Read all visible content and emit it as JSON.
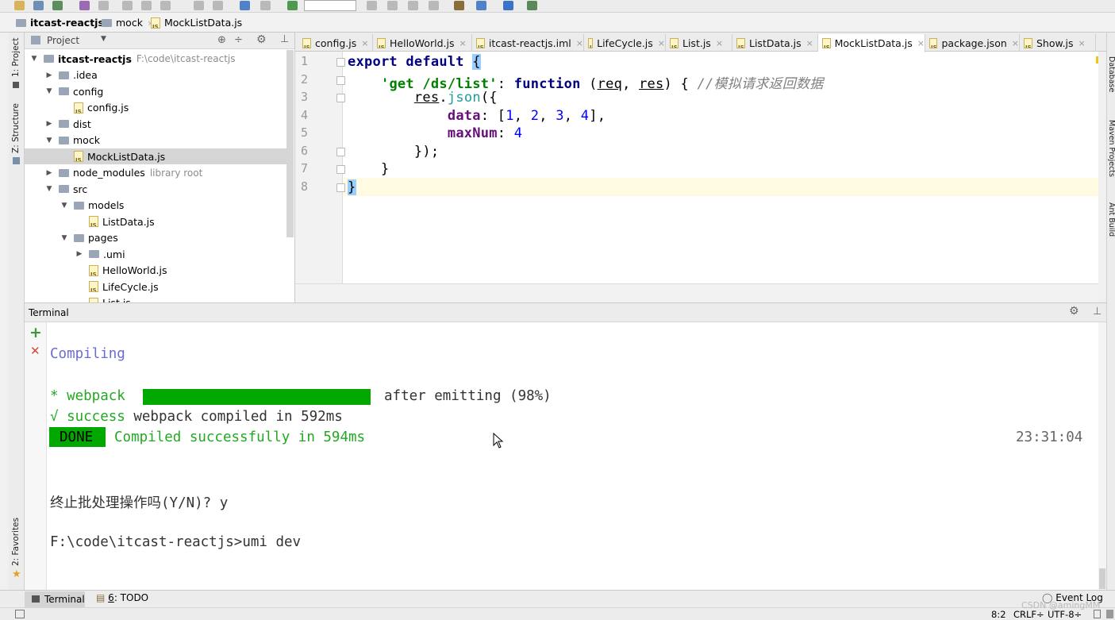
{
  "navbar": {
    "crumbs": [
      "itcast-reactjs",
      "mock",
      "MockListData.js"
    ]
  },
  "left_strip": {
    "project_tab": "1: Project",
    "structure_tab": "Z: Structure",
    "favorites_tab": "2: Favorites"
  },
  "right_strip": {
    "database_tab": "Database",
    "maven_tab": "Maven Projects",
    "ant_tab": "Ant Build"
  },
  "project_panel": {
    "title": "Project",
    "tree": [
      {
        "label": "itcast-reactjs",
        "hint": "F:\\code\\itcast-reactjs",
        "type": "folder",
        "depth": 0,
        "expanded": true
      },
      {
        "label": ".idea",
        "type": "folder",
        "depth": 1,
        "expanded": false
      },
      {
        "label": "config",
        "type": "folder",
        "depth": 1,
        "expanded": true
      },
      {
        "label": "config.js",
        "type": "js",
        "depth": 2
      },
      {
        "label": "dist",
        "type": "folder",
        "depth": 1,
        "expanded": false
      },
      {
        "label": "mock",
        "type": "folder",
        "depth": 1,
        "expanded": true
      },
      {
        "label": "MockListData.js",
        "type": "js",
        "depth": 2,
        "selected": true
      },
      {
        "label": "node_modules",
        "hint": "library root",
        "type": "folder",
        "depth": 1,
        "expanded": false
      },
      {
        "label": "src",
        "type": "folder",
        "depth": 1,
        "expanded": true
      },
      {
        "label": "models",
        "type": "folder",
        "depth": 2,
        "expanded": true
      },
      {
        "label": "ListData.js",
        "type": "js",
        "depth": 3
      },
      {
        "label": "pages",
        "type": "folder",
        "depth": 2,
        "expanded": true
      },
      {
        "label": ".umi",
        "type": "folder",
        "depth": 3,
        "expanded": false
      },
      {
        "label": "HelloWorld.js",
        "type": "js",
        "depth": 3
      },
      {
        "label": "LifeCycle.js",
        "type": "js",
        "depth": 3
      },
      {
        "label": "List.js",
        "type": "js",
        "depth": 3
      }
    ]
  },
  "editor": {
    "tabs": [
      {
        "label": "config.js",
        "active": false
      },
      {
        "label": "HelloWorld.js",
        "active": false
      },
      {
        "label": "itcast-reactjs.iml",
        "active": false
      },
      {
        "label": "LifeCycle.js",
        "active": false
      },
      {
        "label": "List.js",
        "active": false
      },
      {
        "label": "ListData.js",
        "active": false
      },
      {
        "label": "MockListData.js",
        "active": true
      },
      {
        "label": "package.json",
        "active": false
      },
      {
        "label": "Show.js",
        "active": false
      }
    ],
    "line_numbers": [
      "1",
      "2",
      "3",
      "4",
      "5",
      "6",
      "7",
      "8"
    ],
    "code": {
      "l1_kw": "export default",
      "l1_brace": "{",
      "l2_indent": "    ",
      "l2_str": "'get /ds/list'",
      "l2_colon": ": ",
      "l2_fn": "function",
      "l2_open": " (",
      "l2_req": "req",
      "l2_comma": ", ",
      "l2_res": "res",
      "l2_close": ") { ",
      "l2_comment": "//模拟请求返回数据",
      "l3_indent": "        ",
      "l3_res": "res",
      "l3_dot": ".",
      "l3_json": "json",
      "l3_rest": "({",
      "l4_indent": "            ",
      "l4_prop": "data",
      "l4_colon": ": [",
      "l4_n1": "1",
      "l4_c1": ", ",
      "l4_n2": "2",
      "l4_c2": ", ",
      "l4_n3": "3",
      "l4_c3": ", ",
      "l4_n4": "4",
      "l4_end": "],",
      "l5_indent": "            ",
      "l5_prop": "maxNum",
      "l5_colon": ": ",
      "l5_num": "4",
      "l6": "        });",
      "l7": "    }",
      "l8": "}"
    }
  },
  "terminal": {
    "title": "Terminal",
    "lines": {
      "compiling": "Compiling",
      "webpack_star": "* webpack",
      "webpack_after": "after emitting (98%)",
      "webpack_progress": 0.98,
      "success_mark": "√ success",
      "success_rest": " webpack compiled in 592ms",
      "done_badge": "DONE",
      "done_text": "Compiled successfully in 594ms",
      "done_time": "23:31:04",
      "prompt_question": "终止批处理操作吗(Y/N)? y",
      "command": "F:\\code\\itcast-reactjs>umi dev"
    }
  },
  "bottom_tabs": {
    "terminal": "Terminal",
    "todo_num": "6",
    "todo_label": ": TODO",
    "event_log": "Event Log"
  },
  "status_bar": {
    "position": "8:2",
    "line_sep": "CRLF÷",
    "encoding": "UTF-8÷"
  },
  "watermark": "CSDN @amingMM",
  "colors": {
    "accent_green": "#00a800",
    "keyword": "#000080",
    "string": "#008000",
    "number": "#0000ff",
    "comment": "#808080",
    "property": "#660e7a"
  }
}
